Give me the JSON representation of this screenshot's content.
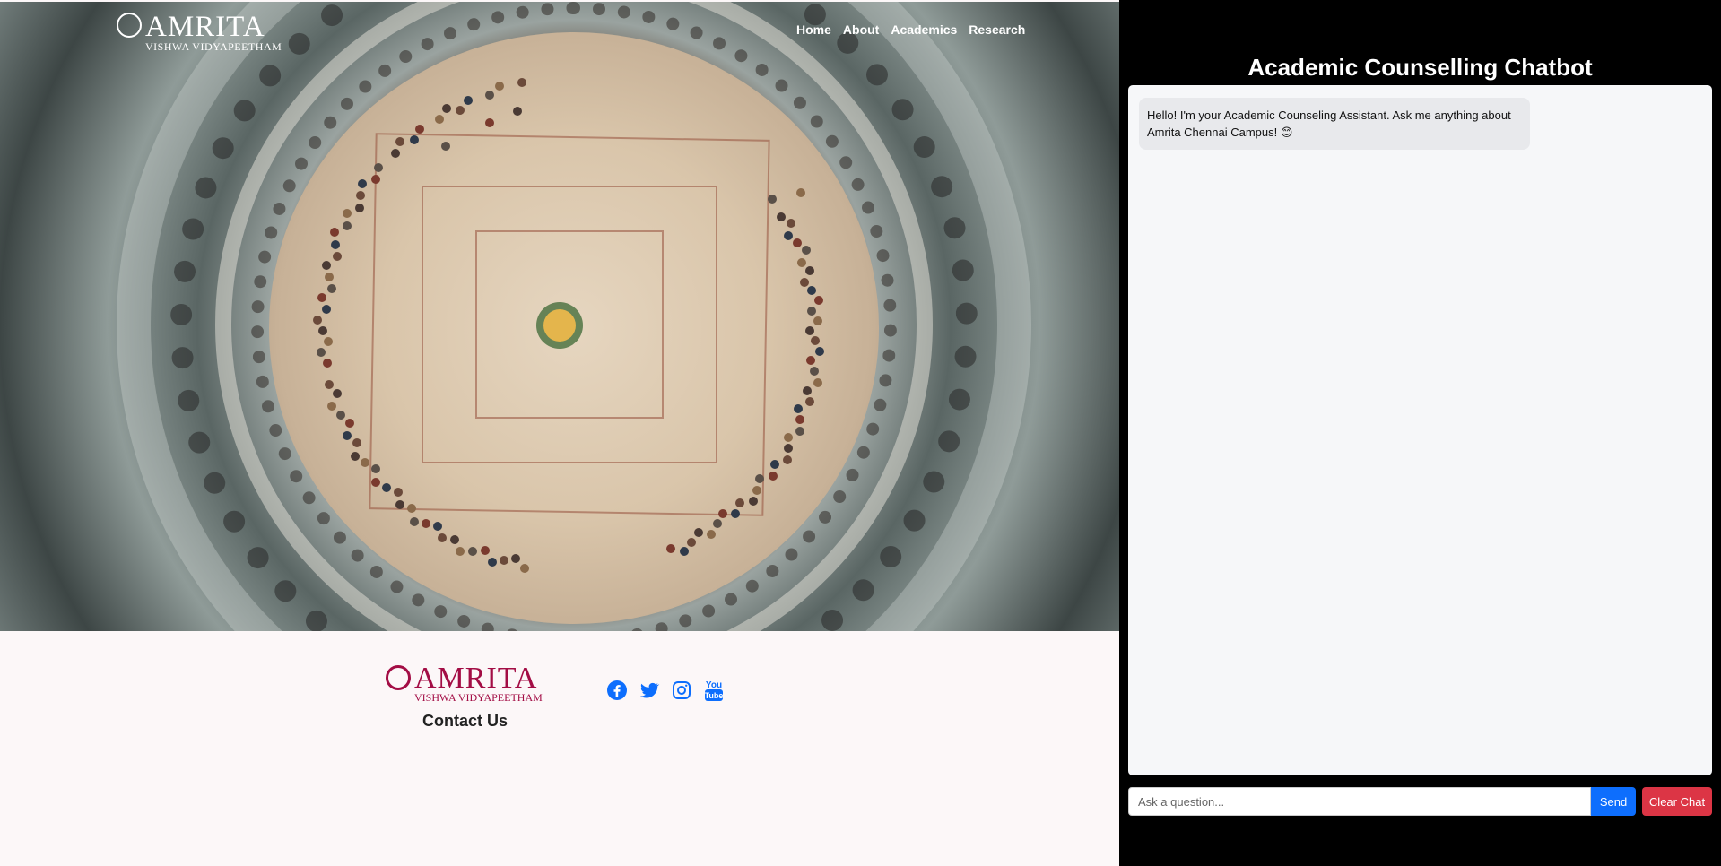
{
  "site": {
    "logo": {
      "word": "AMRITA",
      "sub": "VISHWA VIDYAPEETHAM"
    },
    "nav": {
      "home": "Home",
      "about": "About",
      "academics": "Academics",
      "research": "Research"
    },
    "footer": {
      "logo": {
        "word": "AMRITA",
        "sub": "VISHWA VIDYAPEETHAM"
      },
      "contact": "Contact Us",
      "socials": [
        "facebook-icon",
        "twitter-icon",
        "instagram-icon",
        "youtube-icon"
      ]
    }
  },
  "chat": {
    "title": "Academic Counselling Chatbot",
    "messages": [
      {
        "from": "bot",
        "text": "Hello! I'm your Academic Counseling Assistant. Ask me anything about Amrita Chennai Campus! 😊"
      }
    ],
    "input_placeholder": "Ask a question...",
    "send_label": "Send",
    "clear_label": "Clear Chat"
  },
  "colors": {
    "brand": "#a30d45",
    "send": "#0d6efd",
    "clear": "#dc3545",
    "social": "#0d6efd"
  }
}
